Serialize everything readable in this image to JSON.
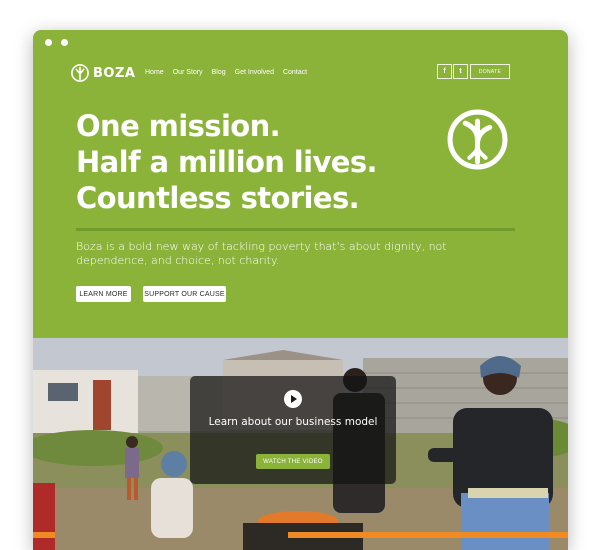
{
  "brand": {
    "name": "BOZA",
    "color": "#8bb33a",
    "accent": "#f08a24"
  },
  "nav": {
    "items": [
      "Home",
      "Our Story",
      "Blog",
      "Get Involved",
      "Contact"
    ]
  },
  "social": {
    "facebook": "f",
    "twitter": "t"
  },
  "header": {
    "donate_label": "DONATE"
  },
  "hero": {
    "headline_lines": [
      "One mission.",
      "Half a million lives.",
      "Countless stories."
    ],
    "tagline": "Boza is a bold new way of tackling poverty that's about dignity, not dependence, and choice, not charity.",
    "learn_more_label": "LEARN MORE",
    "support_label": "SUPPORT OUR CAUSE"
  },
  "video": {
    "title": "Learn about our business model",
    "watch_label": "WATCH THE VIDEO"
  },
  "icons": {
    "logo": "tree-icon",
    "play": "play-icon",
    "emblem": "tree-emblem-icon"
  }
}
